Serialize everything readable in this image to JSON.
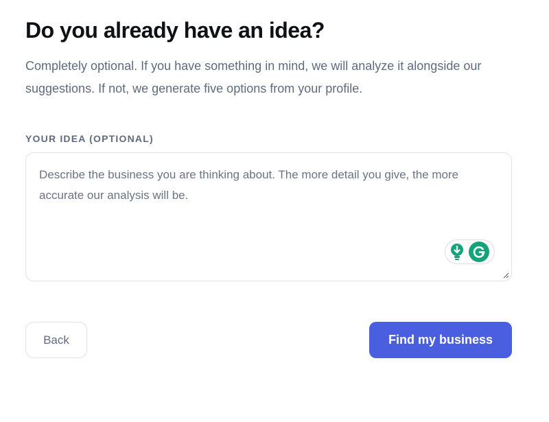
{
  "heading": "Do you already have an idea?",
  "subtitle": "Completely optional. If you have something in mind, we will analyze it alongside our suggestions. If not, we generate five options from your profile.",
  "idea_field": {
    "label": "YOUR IDEA (OPTIONAL)",
    "value": "",
    "placeholder": "Describe the business you are thinking about. The more detail you give, the more accurate our analysis will be."
  },
  "grammarly_widget": {
    "icons": [
      "lightbulb-icon",
      "grammarly-logo-icon"
    ],
    "accent": "#15a37a"
  },
  "buttons": {
    "back_label": "Back",
    "primary_label": "Find my business"
  },
  "colors": {
    "primary": "#4a5ee0",
    "heading": "#0f1115",
    "muted": "#5f6b7d",
    "border": "#dfe2e8"
  }
}
